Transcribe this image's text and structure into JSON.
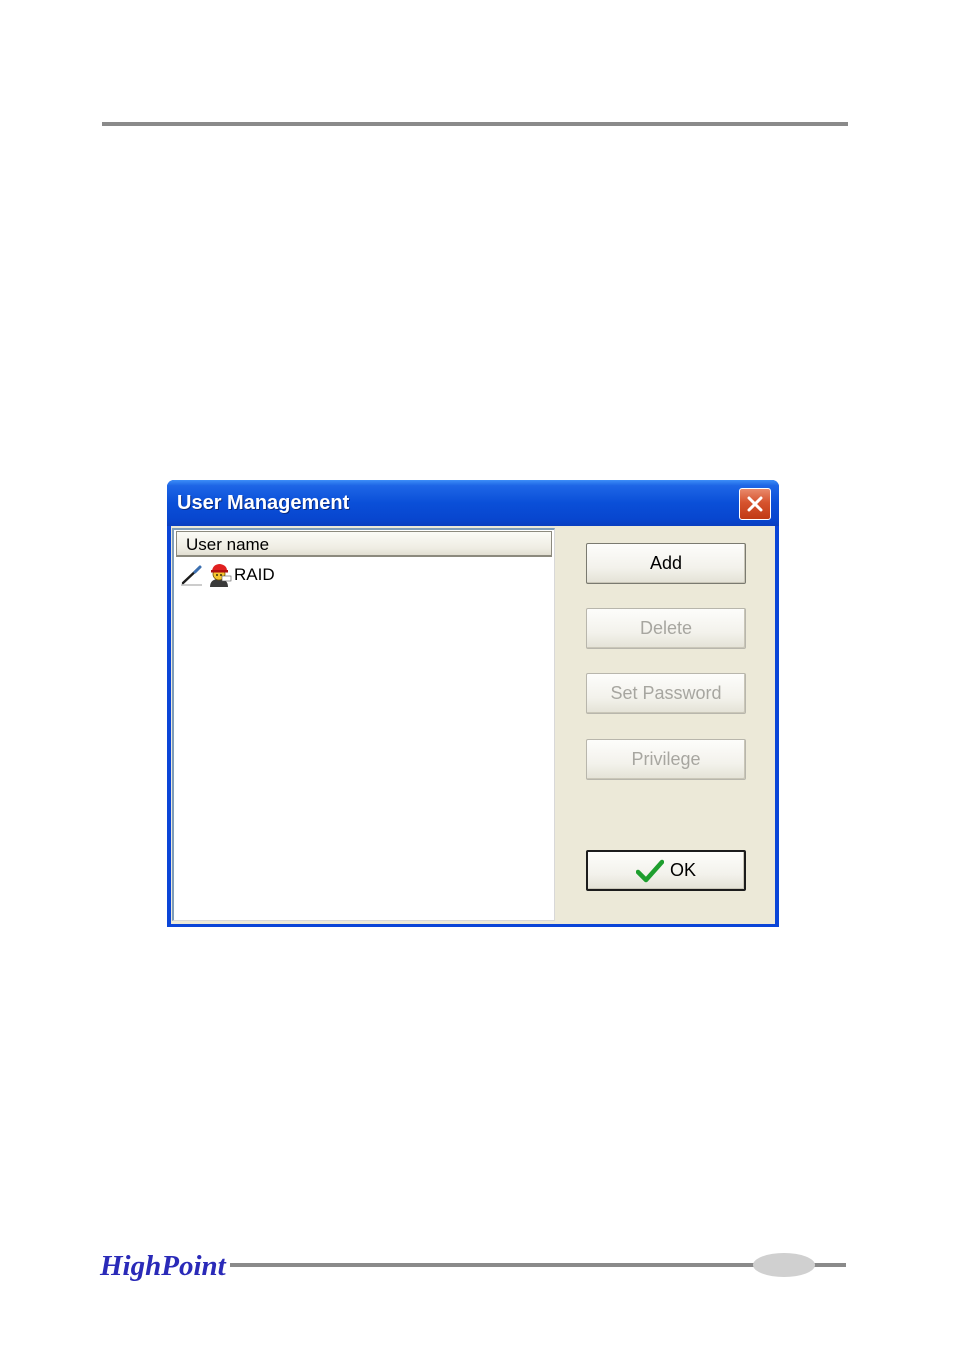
{
  "window": {
    "title": "User Management"
  },
  "list": {
    "column_header": "User name",
    "items": [
      {
        "label": "RAID"
      }
    ]
  },
  "buttons": {
    "add": "Add",
    "delete": "Delete",
    "set_password": "Set Password",
    "privilege": "Privilege",
    "ok": "OK"
  },
  "footer": {
    "brand": "HighPoint"
  },
  "icons": {
    "close": "close-icon",
    "pen": "pen-icon",
    "user": "user-icon",
    "ok_check": "checkmark-icon"
  },
  "colors": {
    "titlebar": "#0A4FD8",
    "close_button": "#D6532E",
    "dialog_face": "#ECE9D8",
    "disabled_text": "#A7A6A0",
    "brand_blue": "#2A2AB8",
    "checkmark": "#1E9E2E"
  }
}
